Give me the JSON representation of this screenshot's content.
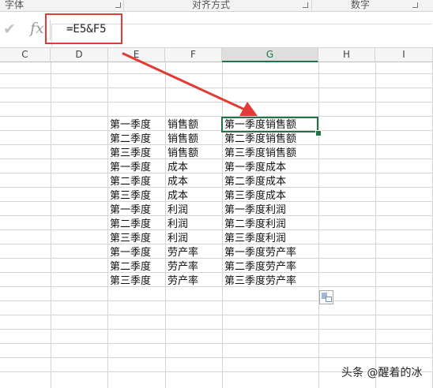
{
  "ribbon": {
    "groups": [
      "字体",
      "对齐方式",
      "数字"
    ]
  },
  "formula_bar": {
    "cancel_icon": "check-icon",
    "function_icon": "fx",
    "formula": "=E5&F5"
  },
  "columns": [
    "C",
    "D",
    "E",
    "F",
    "G",
    "H",
    "I"
  ],
  "selected_column": "G",
  "rows": [
    {
      "e": "第一季度",
      "f": "销售额",
      "g": "第一季度销售额"
    },
    {
      "e": "第二季度",
      "f": "销售额",
      "g": "第二季度销售额"
    },
    {
      "e": "第三季度",
      "f": "销售额",
      "g": "第三季度销售额"
    },
    {
      "e": "第一季度",
      "f": "成本",
      "g": "第一季度成本"
    },
    {
      "e": "第二季度",
      "f": "成本",
      "g": "第二季度成本"
    },
    {
      "e": "第三季度",
      "f": "成本",
      "g": "第三季度成本"
    },
    {
      "e": "第一季度",
      "f": "利润",
      "g": "第一季度利润"
    },
    {
      "e": "第二季度",
      "f": "利润",
      "g": "第二季度利润"
    },
    {
      "e": "第三季度",
      "f": "利润",
      "g": "第三季度利润"
    },
    {
      "e": "第一季度",
      "f": "劳产率",
      "g": "第一季度劳产率"
    },
    {
      "e": "第二季度",
      "f": "劳产率",
      "g": "第二季度劳产率"
    },
    {
      "e": "第三季度",
      "f": "劳产率",
      "g": "第三季度劳产率"
    }
  ],
  "watermark": "头条 @醒着的冰",
  "colors": {
    "annotation": "#e23a37",
    "selection": "#217346"
  }
}
